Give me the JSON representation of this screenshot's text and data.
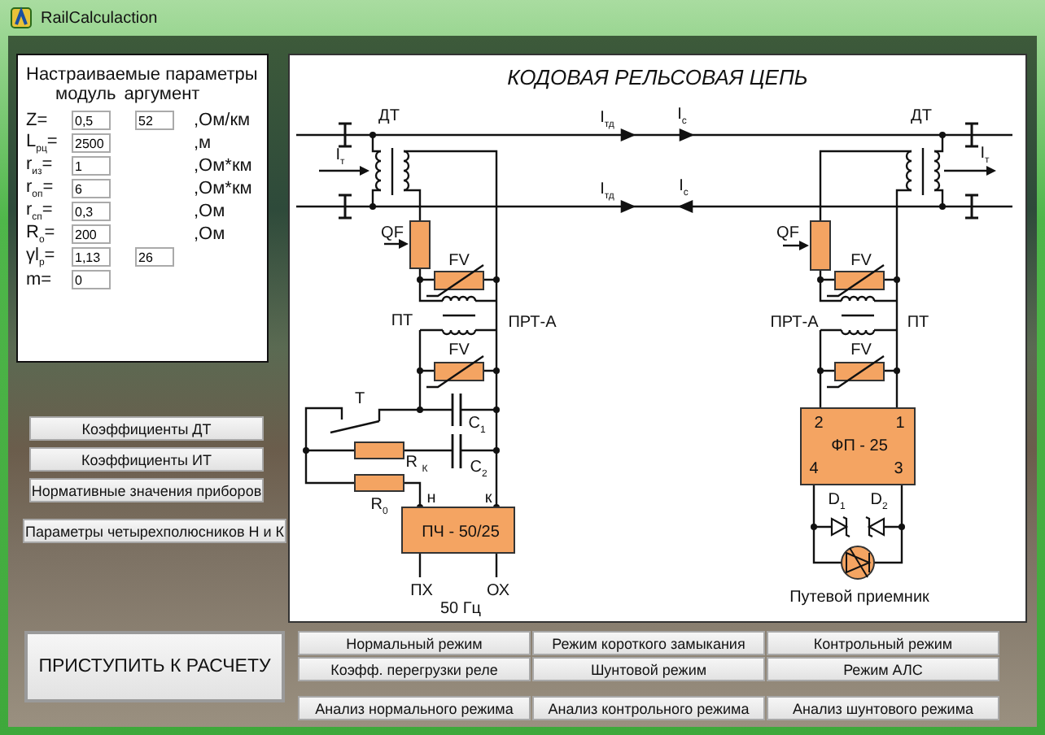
{
  "window": {
    "title": "RailCalculaction"
  },
  "params": {
    "title": "Настраиваемые параметры",
    "col_module": "модуль",
    "col_argument": "аргумент",
    "rows": [
      {
        "label": "Z=",
        "module": "0,5",
        "argument": "52",
        "unit": ",Ом/км"
      },
      {
        "label": "L$_{рц}$=",
        "module": "2500",
        "unit": ",м"
      },
      {
        "label": "r$_{из}$=",
        "module": "1",
        "unit": ",Ом*км"
      },
      {
        "label": "r$_{оп}$=",
        "module": "6",
        "unit": ",Ом*км"
      },
      {
        "label": "r$_{сп}$=",
        "module": "0,3",
        "unit": ",Ом"
      },
      {
        "label": "R$_{о}$=",
        "module": "200",
        "unit": ",Ом"
      },
      {
        "label": "γl$_{р}$=",
        "module": "1,13",
        "argument": "26"
      },
      {
        "label": "m=",
        "module": "0"
      }
    ]
  },
  "side_buttons": [
    "Коэффициенты ДТ",
    "Коэффициенты ИТ",
    "Нормативные значения приборов",
    "Параметры четырехполюсников Н и К"
  ],
  "diagram": {
    "title": "КОДОВАЯ РЕЛЬСОВАЯ ЦЕПЬ",
    "labels": [
      "ДТ",
      "I$_{т}$",
      "I$_{тд}$",
      "I$_{с}$",
      "I$_{тд}$",
      "I$_{с}$",
      "ДТ",
      "I$_{т}$",
      "QF",
      "FV",
      "QF",
      "FV",
      "ПТ",
      "ПРТ-А",
      "ПРТ-А",
      "ПТ",
      "FV",
      "FV",
      "Т",
      "C$_{1}$",
      "R $_{К}$",
      "C$_{2}$",
      "R$_{0}$",
      "н",
      "к",
      "ПЧ - 50/25",
      "ПХ",
      "ОХ",
      "50 Гц",
      "2",
      "1",
      "ФП - 25",
      "4",
      "3",
      "D$_{1}$",
      "D$_{2}$",
      "Путевой приемник"
    ]
  },
  "start_button": "ПРИСТУПИТЬ К РАСЧЕТУ",
  "mode_buttons": [
    "Нормальный режим",
    "Режим короткого замыкания",
    "Контрольный режим",
    "Коэфф. перегрузки реле",
    "Шунтовой режим",
    "Режим АЛС"
  ],
  "analysis_buttons": [
    "Анализ нормального режима",
    "Анализ контрольного режима",
    "Анализ шунтового режима"
  ]
}
